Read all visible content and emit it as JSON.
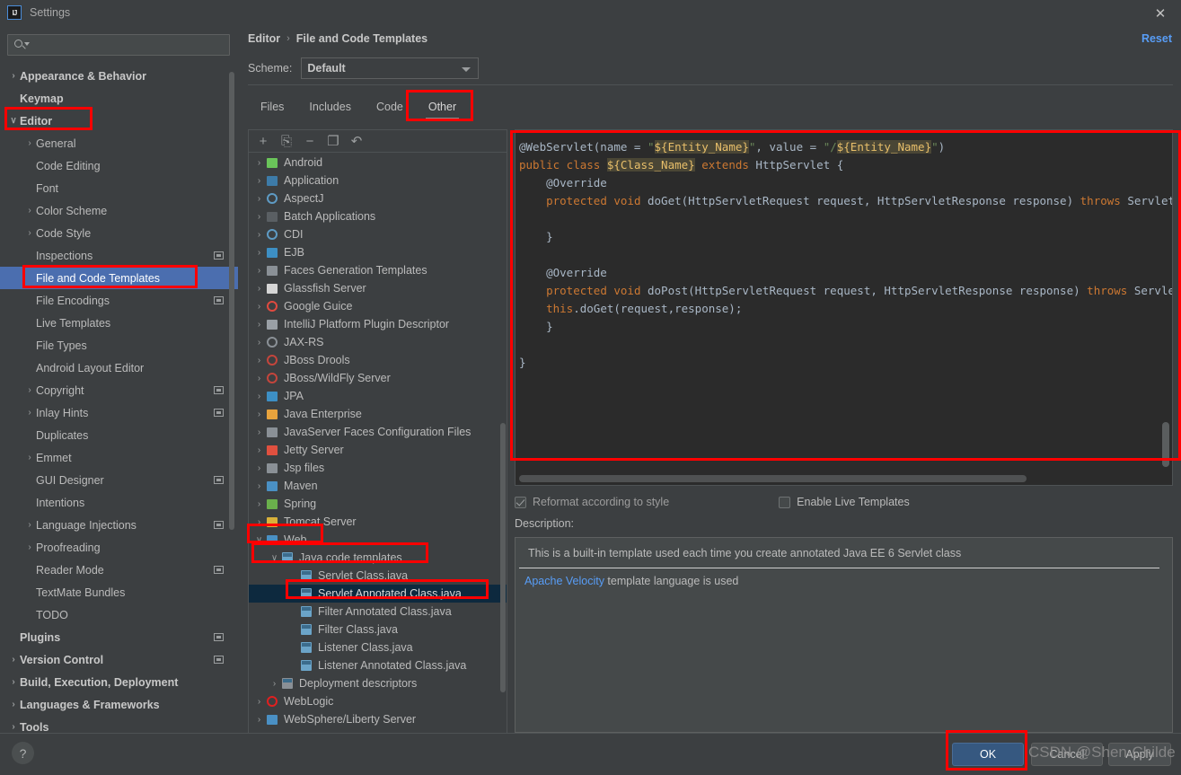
{
  "window": {
    "title": "Settings",
    "logo_text": "IJ",
    "close_icon": "close-icon"
  },
  "search": {
    "value": "",
    "placeholder": ""
  },
  "sidebar": {
    "items": [
      {
        "label": "Appearance & Behavior",
        "level": 0,
        "arrow": ">",
        "bold": true,
        "badge": false,
        "selected": false
      },
      {
        "label": "Keymap",
        "level": 0,
        "arrow": "",
        "bold": true,
        "badge": false,
        "selected": false
      },
      {
        "label": "Editor",
        "level": 0,
        "arrow": "v",
        "bold": true,
        "badge": false,
        "selected": false
      },
      {
        "label": "General",
        "level": 1,
        "arrow": ">",
        "bold": false,
        "badge": false,
        "selected": false
      },
      {
        "label": "Code Editing",
        "level": 1,
        "arrow": "",
        "bold": false,
        "badge": false,
        "selected": false
      },
      {
        "label": "Font",
        "level": 1,
        "arrow": "",
        "bold": false,
        "badge": false,
        "selected": false
      },
      {
        "label": "Color Scheme",
        "level": 1,
        "arrow": ">",
        "bold": false,
        "badge": false,
        "selected": false
      },
      {
        "label": "Code Style",
        "level": 1,
        "arrow": ">",
        "bold": false,
        "badge": false,
        "selected": false
      },
      {
        "label": "Inspections",
        "level": 1,
        "arrow": "",
        "bold": false,
        "badge": true,
        "selected": false
      },
      {
        "label": "File and Code Templates",
        "level": 1,
        "arrow": "",
        "bold": false,
        "badge": false,
        "selected": true
      },
      {
        "label": "File Encodings",
        "level": 1,
        "arrow": "",
        "bold": false,
        "badge": true,
        "selected": false
      },
      {
        "label": "Live Templates",
        "level": 1,
        "arrow": "",
        "bold": false,
        "badge": false,
        "selected": false
      },
      {
        "label": "File Types",
        "level": 1,
        "arrow": "",
        "bold": false,
        "badge": false,
        "selected": false
      },
      {
        "label": "Android Layout Editor",
        "level": 1,
        "arrow": "",
        "bold": false,
        "badge": false,
        "selected": false
      },
      {
        "label": "Copyright",
        "level": 1,
        "arrow": ">",
        "bold": false,
        "badge": true,
        "selected": false
      },
      {
        "label": "Inlay Hints",
        "level": 1,
        "arrow": ">",
        "bold": false,
        "badge": true,
        "selected": false
      },
      {
        "label": "Duplicates",
        "level": 1,
        "arrow": "",
        "bold": false,
        "badge": false,
        "selected": false
      },
      {
        "label": "Emmet",
        "level": 1,
        "arrow": ">",
        "bold": false,
        "badge": false,
        "selected": false
      },
      {
        "label": "GUI Designer",
        "level": 1,
        "arrow": "",
        "bold": false,
        "badge": true,
        "selected": false
      },
      {
        "label": "Intentions",
        "level": 1,
        "arrow": "",
        "bold": false,
        "badge": false,
        "selected": false
      },
      {
        "label": "Language Injections",
        "level": 1,
        "arrow": ">",
        "bold": false,
        "badge": true,
        "selected": false
      },
      {
        "label": "Proofreading",
        "level": 1,
        "arrow": ">",
        "bold": false,
        "badge": false,
        "selected": false
      },
      {
        "label": "Reader Mode",
        "level": 1,
        "arrow": "",
        "bold": false,
        "badge": true,
        "selected": false
      },
      {
        "label": "TextMate Bundles",
        "level": 1,
        "arrow": "",
        "bold": false,
        "badge": false,
        "selected": false
      },
      {
        "label": "TODO",
        "level": 1,
        "arrow": "",
        "bold": false,
        "badge": false,
        "selected": false
      },
      {
        "label": "Plugins",
        "level": 0,
        "arrow": "",
        "bold": true,
        "badge": true,
        "selected": false
      },
      {
        "label": "Version Control",
        "level": 0,
        "arrow": ">",
        "bold": true,
        "badge": true,
        "selected": false
      },
      {
        "label": "Build, Execution, Deployment",
        "level": 0,
        "arrow": ">",
        "bold": true,
        "badge": false,
        "selected": false
      },
      {
        "label": "Languages & Frameworks",
        "level": 0,
        "arrow": ">",
        "bold": true,
        "badge": false,
        "selected": false
      },
      {
        "label": "Tools",
        "level": 0,
        "arrow": ">",
        "bold": true,
        "badge": false,
        "selected": false
      }
    ],
    "help_label": "?"
  },
  "header": {
    "breadcrumb": [
      "Editor",
      "File and Code Templates"
    ],
    "separator": "›",
    "reset_label": "Reset",
    "scheme_label": "Scheme:",
    "scheme_value": "Default"
  },
  "tabs": [
    {
      "label": "Files",
      "active": false
    },
    {
      "label": "Includes",
      "active": false
    },
    {
      "label": "Code",
      "active": false
    },
    {
      "label": "Other",
      "active": true
    }
  ],
  "tree_toolbar": [
    {
      "name": "add-template-button",
      "glyph": "+"
    },
    {
      "name": "copy-template-button",
      "glyph": "⎘"
    },
    {
      "name": "remove-template-button",
      "glyph": "−"
    },
    {
      "name": "duplicate-template-button",
      "glyph": "❐"
    },
    {
      "name": "reset-template-button",
      "glyph": "↶"
    }
  ],
  "template_tree": [
    {
      "label": "Android",
      "level": 1,
      "arrow": ">",
      "icon": "android-icon",
      "color": "#6ac45a",
      "selected": false
    },
    {
      "label": "Application",
      "level": 1,
      "arrow": ">",
      "icon": "application-icon",
      "color": "#3d7ba8",
      "selected": false
    },
    {
      "label": "AspectJ",
      "level": 1,
      "arrow": ">",
      "icon": "aspectj-icon",
      "color": "#5e9bc4",
      "selected": false
    },
    {
      "label": "Batch Applications",
      "level": 1,
      "arrow": ">",
      "icon": "batch-folder-icon",
      "color": "#5a5f63",
      "selected": false
    },
    {
      "label": "CDI",
      "level": 1,
      "arrow": ">",
      "icon": "cdi-icon",
      "color": "#5e9bc4",
      "selected": false
    },
    {
      "label": "EJB",
      "level": 1,
      "arrow": ">",
      "icon": "ejb-icon",
      "color": "#3d8fc4",
      "selected": false
    },
    {
      "label": "Faces Generation Templates",
      "level": 1,
      "arrow": ">",
      "icon": "jsf-icon",
      "color": "#8a9096",
      "selected": false
    },
    {
      "label": "Glassfish Server",
      "level": 1,
      "arrow": ">",
      "icon": "glassfish-icon",
      "color": "#d5d5d5",
      "selected": false
    },
    {
      "label": "Google Guice",
      "level": 1,
      "arrow": ">",
      "icon": "google-icon",
      "color": "#e04a3f",
      "selected": false
    },
    {
      "label": "IntelliJ Platform Plugin Descriptor",
      "level": 1,
      "arrow": ">",
      "icon": "plugin-icon",
      "color": "#9aa0a6",
      "selected": false
    },
    {
      "label": "JAX-RS",
      "level": 1,
      "arrow": ">",
      "icon": "globe-icon",
      "color": "#8a9096",
      "selected": false
    },
    {
      "label": "JBoss Drools",
      "level": 1,
      "arrow": ">",
      "icon": "drools-icon",
      "color": "#c4453c",
      "selected": false
    },
    {
      "label": "JBoss/WildFly Server",
      "level": 1,
      "arrow": ">",
      "icon": "wildfly-icon",
      "color": "#c4453c",
      "selected": false
    },
    {
      "label": "JPA",
      "level": 1,
      "arrow": ">",
      "icon": "jpa-icon",
      "color": "#3d8fc4",
      "selected": false
    },
    {
      "label": "Java Enterprise",
      "level": 1,
      "arrow": ">",
      "icon": "java-ee-icon",
      "color": "#e8a33d",
      "selected": false
    },
    {
      "label": "JavaServer Faces Configuration Files",
      "level": 1,
      "arrow": ">",
      "icon": "jsf-icon",
      "color": "#8a9096",
      "selected": false
    },
    {
      "label": "Jetty Server",
      "level": 1,
      "arrow": ">",
      "icon": "jetty-icon",
      "color": "#e0503f",
      "selected": false
    },
    {
      "label": "Jsp files",
      "level": 1,
      "arrow": ">",
      "icon": "jsp-icon",
      "color": "#8a9096",
      "selected": false
    },
    {
      "label": "Maven",
      "level": 1,
      "arrow": ">",
      "icon": "maven-icon",
      "color": "#4a90c4",
      "selected": false
    },
    {
      "label": "Spring",
      "level": 1,
      "arrow": ">",
      "icon": "spring-icon",
      "color": "#6ab04c",
      "selected": false
    },
    {
      "label": "Tomcat Server",
      "level": 1,
      "arrow": ">",
      "icon": "tomcat-icon",
      "color": "#d8b13a",
      "selected": false
    },
    {
      "label": "Web",
      "level": 1,
      "arrow": "v",
      "icon": "web-icon",
      "color": "#4a90c4",
      "selected": false
    },
    {
      "label": "Java code templates",
      "level": 2,
      "arrow": "v",
      "icon": "java-file-icon",
      "color": "#6ba4c8",
      "selected": false
    },
    {
      "label": "Servlet Class.java",
      "level": 3,
      "arrow": "",
      "icon": "java-file-icon",
      "color": "#6ba4c8",
      "selected": false
    },
    {
      "label": "Servlet Annotated Class.java",
      "level": 3,
      "arrow": "",
      "icon": "java-file-icon",
      "color": "#6ba4c8",
      "selected": true
    },
    {
      "label": "Filter Annotated Class.java",
      "level": 3,
      "arrow": "",
      "icon": "java-file-icon",
      "color": "#6ba4c8",
      "selected": false
    },
    {
      "label": "Filter Class.java",
      "level": 3,
      "arrow": "",
      "icon": "java-file-icon",
      "color": "#6ba4c8",
      "selected": false
    },
    {
      "label": "Listener Class.java",
      "level": 3,
      "arrow": "",
      "icon": "java-file-icon",
      "color": "#6ba4c8",
      "selected": false
    },
    {
      "label": "Listener Annotated Class.java",
      "level": 3,
      "arrow": "",
      "icon": "java-file-icon",
      "color": "#6ba4c8",
      "selected": false
    },
    {
      "label": "Deployment descriptors",
      "level": 2,
      "arrow": ">",
      "icon": "xml-file-icon",
      "color": "#8a9096",
      "selected": false
    },
    {
      "label": "WebLogic",
      "level": 1,
      "arrow": ">",
      "icon": "weblogic-icon",
      "color": "#e02020",
      "selected": false
    },
    {
      "label": "WebSphere/Liberty Server",
      "level": 1,
      "arrow": ">",
      "icon": "websphere-icon",
      "color": "#4a90c4",
      "selected": false
    }
  ],
  "editor": {
    "lines": [
      [
        {
          "t": "@WebServlet(name = ",
          "c": "plain"
        },
        {
          "t": "\"",
          "c": "str"
        },
        {
          "t": "${Entity_Name}",
          "c": "var"
        },
        {
          "t": "\"",
          "c": "str"
        },
        {
          "t": ", value = ",
          "c": "plain"
        },
        {
          "t": "\"/",
          "c": "str"
        },
        {
          "t": "${Entity_Name}",
          "c": "var"
        },
        {
          "t": "\"",
          "c": "str"
        },
        {
          "t": ")",
          "c": "plain"
        }
      ],
      [
        {
          "t": "public class ",
          "c": "kw"
        },
        {
          "t": "${Class_Name}",
          "c": "var"
        },
        {
          "t": " ",
          "c": "plain"
        },
        {
          "t": "extends",
          "c": "kw"
        },
        {
          "t": " HttpServlet {",
          "c": "plain"
        }
      ],
      [
        {
          "t": "    @Override",
          "c": "plain"
        }
      ],
      [
        {
          "t": "    ",
          "c": "plain"
        },
        {
          "t": "protected void",
          "c": "kw"
        },
        {
          "t": " doGet(HttpServletRequest request, HttpServletResponse response) ",
          "c": "plain"
        },
        {
          "t": "throws",
          "c": "kw"
        },
        {
          "t": " ServletExcept",
          "c": "plain"
        }
      ],
      [
        {
          "t": "",
          "c": "plain"
        }
      ],
      [
        {
          "t": "    }",
          "c": "plain"
        }
      ],
      [
        {
          "t": "",
          "c": "plain"
        }
      ],
      [
        {
          "t": "    @Override",
          "c": "plain"
        }
      ],
      [
        {
          "t": "    ",
          "c": "plain"
        },
        {
          "t": "protected void",
          "c": "kw"
        },
        {
          "t": " doPost(HttpServletRequest request, HttpServletResponse response) ",
          "c": "plain"
        },
        {
          "t": "throws",
          "c": "kw"
        },
        {
          "t": " ServletExcep",
          "c": "plain"
        }
      ],
      [
        {
          "t": "    ",
          "c": "plain"
        },
        {
          "t": "this",
          "c": "kw"
        },
        {
          "t": ".doGet(request,response);",
          "c": "plain"
        }
      ],
      [
        {
          "t": "    }",
          "c": "plain"
        }
      ],
      [
        {
          "t": "",
          "c": "plain"
        }
      ],
      [
        {
          "t": "}",
          "c": "plain"
        }
      ]
    ]
  },
  "options": {
    "reformat_label": "Reformat according to style",
    "reformat_checked": true,
    "live_templates_label": "Enable Live Templates",
    "live_templates_checked": false
  },
  "description": {
    "label": "Description:",
    "text": "This is a built-in template used each time you create annotated Java EE 6 Servlet class",
    "velocity_link": "Apache Velocity",
    "velocity_rest": " template language is used"
  },
  "footer": {
    "ok_label": "OK",
    "cancel_label": "Cancel",
    "apply_label": "Apply",
    "watermark": "CSDN @Shen-Childe"
  },
  "colors": {
    "accent": "#4b6eaf",
    "link": "#589df6",
    "annotation": "#ff0000",
    "selection": "#0d293e",
    "editor_bg": "#2b2b2b"
  }
}
